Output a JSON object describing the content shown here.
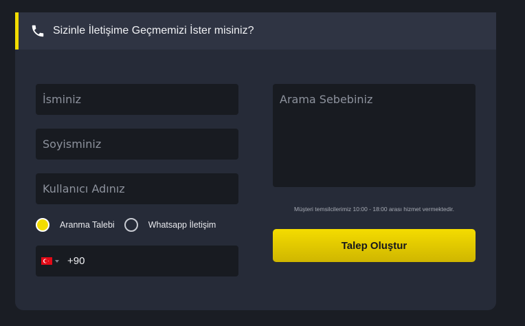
{
  "header": {
    "title": "Sizinle İletişime Geçmemizi İster misiniz?",
    "icon": "phone-icon"
  },
  "form": {
    "name_placeholder": "İsminiz",
    "surname_placeholder": "Soyisminiz",
    "username_placeholder": "Kullanıcı Adınız",
    "reason_placeholder": "Arama Sebebiniz",
    "contact_options": [
      {
        "label": "Aranma Talebi",
        "selected": true
      },
      {
        "label": "Whatsapp İletişim",
        "selected": false
      }
    ],
    "phone": {
      "country_flag": "turkey-flag",
      "dial_code": "+90"
    },
    "note": "Müşteri temsilcilerimiz 10:00 - 18:00 arası hizmet vermektedir.",
    "submit_label": "Talep Oluştur"
  },
  "colors": {
    "accent": "#f2dc00",
    "background": "#1a1d24",
    "card": "#262b38",
    "input": "#181b21"
  }
}
